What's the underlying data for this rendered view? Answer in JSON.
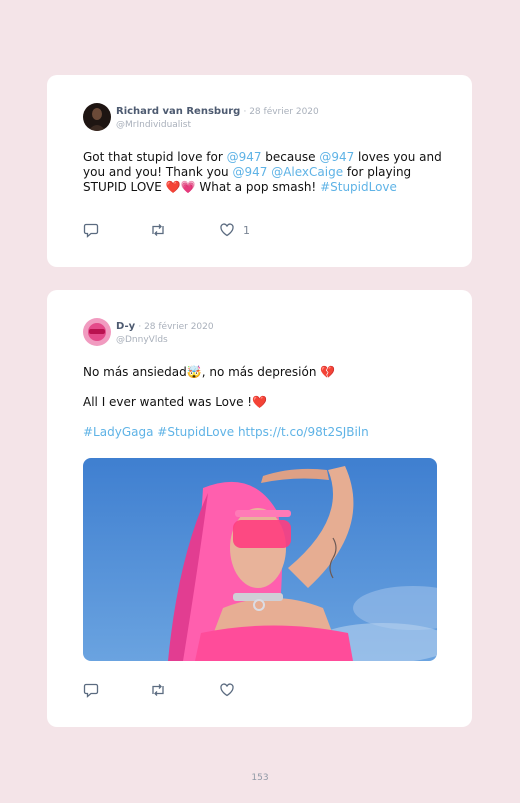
{
  "tweets": [
    {
      "name": "Richard van Rensburg",
      "date": "· 28 février 2020",
      "handle": "@MrIndividualist",
      "text": {
        "s1": "Got that stupid love for ",
        "m1": "@947",
        "s2": " because ",
        "m2": "@947",
        "s3": " loves you and you and you! Thank you ",
        "m3": "@947",
        "s4": " ",
        "m4": "@AlexCaige",
        "s5": " for playing STUPID LOVE ",
        "emoji": "❤️💗",
        "s6": " What a pop smash! ",
        "tag": "#StupidLove"
      },
      "like_count": "1"
    },
    {
      "name": "D-y",
      "date": "· 28 février 2020",
      "handle": "@DnnyVlds",
      "line1": "No más ansiedad",
      "emoji1": "🤯",
      "line1b": ", no más depresión ",
      "emoji2": "💔",
      "line2": "All I ever wanted was Love !",
      "emoji3": "❤️",
      "tag1": "#LadyGaga",
      "tag2": "#StupidLove",
      "url": "https://t.co/98t2SJBiln"
    }
  ],
  "icons": [
    "reply-icon",
    "retweet-icon",
    "like-icon"
  ],
  "colors": {
    "link": "#5fb3e6",
    "background": "#f4e4e8",
    "card": "#ffffff"
  },
  "page_number": "153"
}
